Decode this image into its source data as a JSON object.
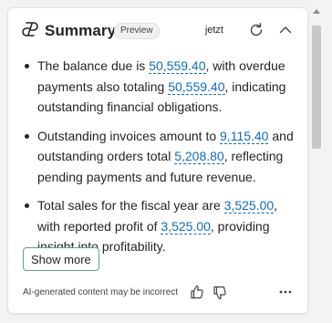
{
  "header": {
    "title": "Summary",
    "badge": "Preview",
    "timestamp": "jetzt",
    "logo_icon": "copilot-logo-icon",
    "refresh_icon": "refresh-icon",
    "collapse_icon": "chevron-up-icon"
  },
  "summary": {
    "items": [
      {
        "pre1": "The balance due is ",
        "amount1": "50,559.40",
        "mid": ", with overdue payments also totaling ",
        "amount2": "50,559.40",
        "post": ", indicating outstanding financial obligations."
      },
      {
        "pre1": "Outstanding invoices amount to ",
        "amount1": "9,115.40",
        "mid": " and outstanding orders total ",
        "amount2": "5,208.80",
        "post": ", reflecting pending payments and future revenue."
      },
      {
        "pre1": "Total sales for the fiscal year are ",
        "amount1": "3,525.00",
        "mid": ", with reported profit of ",
        "amount2": "3,525.00",
        "post": ", providing insight into profitability."
      }
    ]
  },
  "actions": {
    "show_more": "Show more"
  },
  "footer": {
    "disclaimer": "AI-generated content may be incorrect",
    "thumb_up_icon": "thumbs-up-icon",
    "thumb_down_icon": "thumbs-down-icon",
    "more_icon": "more-options-icon"
  },
  "colors": {
    "accent": "#0f6cbd",
    "button_border": "#5aa0a0",
    "text": "#242424"
  }
}
